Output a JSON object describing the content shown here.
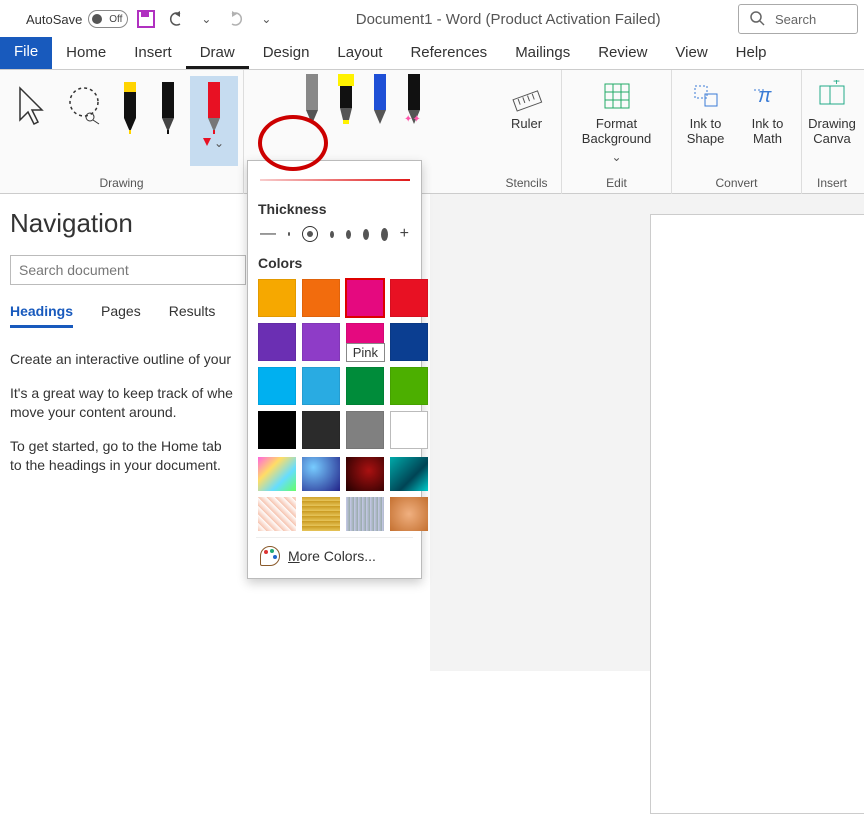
{
  "titlebar": {
    "autosave_label": "AutoSave",
    "autosave_state": "Off",
    "doc_title": "Document1  -  Word (Product Activation Failed)"
  },
  "search": {
    "placeholder": "Search"
  },
  "tabs": {
    "file": "File",
    "items": [
      "Home",
      "Insert",
      "Draw",
      "Design",
      "Layout",
      "References",
      "Mailings",
      "Review",
      "View",
      "Help"
    ],
    "active_index": 2
  },
  "ribbon": {
    "drawing_label": "Drawing",
    "stencils_label": "Stencils",
    "edit_label": "Edit",
    "convert_label": "Convert",
    "insert_label": "Insert",
    "ruler": "Ruler",
    "format_bg": "Format Background",
    "ink_shape": "Ink to Shape",
    "ink_math": "Ink to Math",
    "drawing_canvas": "Drawing Canva"
  },
  "pen_panel": {
    "thickness_label": "Thickness",
    "colors_label": "Colors",
    "more_colors": "ore Colors...",
    "more_colors_leading": "M",
    "colors": [
      {
        "hex": "#F6A800"
      },
      {
        "hex": "#F26C0D"
      },
      {
        "hex": "#E5097F",
        "selected": true
      },
      {
        "hex": "#E81123"
      },
      {
        "hex": "#6B2FB3"
      },
      {
        "hex": "#8E3CC7"
      },
      {
        "hex": "#E5097F",
        "tooltip": "Pink"
      },
      {
        "hex": "#0B3E91"
      },
      {
        "hex": "#00B0F0"
      },
      {
        "hex": "#29ABE2"
      },
      {
        "hex": "#008C3A"
      },
      {
        "hex": "#4CAF00"
      },
      {
        "hex": "#000000"
      },
      {
        "hex": "#2B2B2B"
      },
      {
        "hex": "#808080"
      },
      {
        "hex": "#FFFFFF"
      }
    ],
    "textures": [
      "linear-gradient(135deg,#f6d,#fd6,#6df,#6f6)",
      "radial-gradient(circle at 30% 30%, #7cf, #228)",
      "radial-gradient(circle at 60% 40%, #a11, #200)",
      "linear-gradient(135deg,#0aa,#045 60%,#0cc)",
      "repeating-linear-gradient(45deg,#f6c4b0,#fff 6px)",
      "repeating-linear-gradient(0deg,#e6c45a,#c99a20 5px)",
      "repeating-linear-gradient(90deg,#c5c9e8,#9aa 4px)",
      "radial-gradient(circle,#f0b080,#c47030)"
    ]
  },
  "nav": {
    "title": "Navigation",
    "search_placeholder": "Search document",
    "tabs": [
      "Headings",
      "Pages",
      "Results"
    ],
    "active_tab": 0,
    "body": [
      "Create an interactive outline of your",
      "It's a great way to keep track of whe",
      "move your content around.",
      "To get started, go to the Home tab",
      "to the headings in your document."
    ]
  }
}
